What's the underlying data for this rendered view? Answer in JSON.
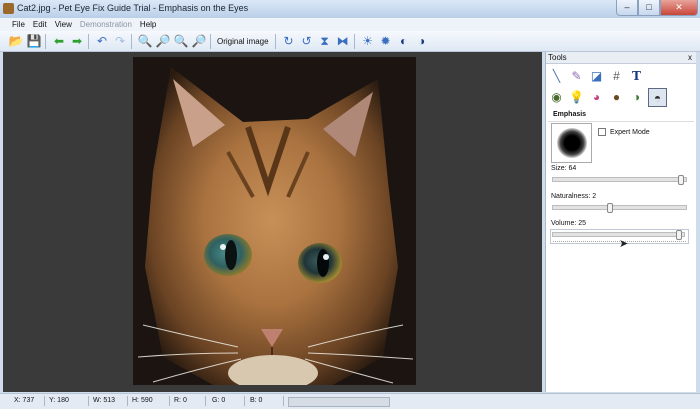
{
  "window": {
    "title": "Cat2.jpg - Pet Eye Fix Guide Trial - Emphasis on the Eyes",
    "minimize": "–",
    "maximize": "□",
    "close": "✕"
  },
  "menu": {
    "file": "File",
    "edit": "Edit",
    "view": "View",
    "demonstration": "Demonstration",
    "help": "Help"
  },
  "toolbar": {
    "original_image_label": "Original image"
  },
  "tools": {
    "header": "Tools",
    "close": "x",
    "panel_title": "Emphasis",
    "expert_mode_label": "Expert Mode",
    "size_label": "Size: 64",
    "naturalness_label": "Naturalness: 2",
    "volume_label": "Volume: 25",
    "size_level": 1.0,
    "naturalness_level": 0.43,
    "volume_level": 1.0
  },
  "status": {
    "x": "X: 737",
    "y": "Y: 180",
    "w": "W: 513",
    "h": "H: 590",
    "r": "R: 0",
    "g": "G: 0",
    "b": "B: 0"
  }
}
